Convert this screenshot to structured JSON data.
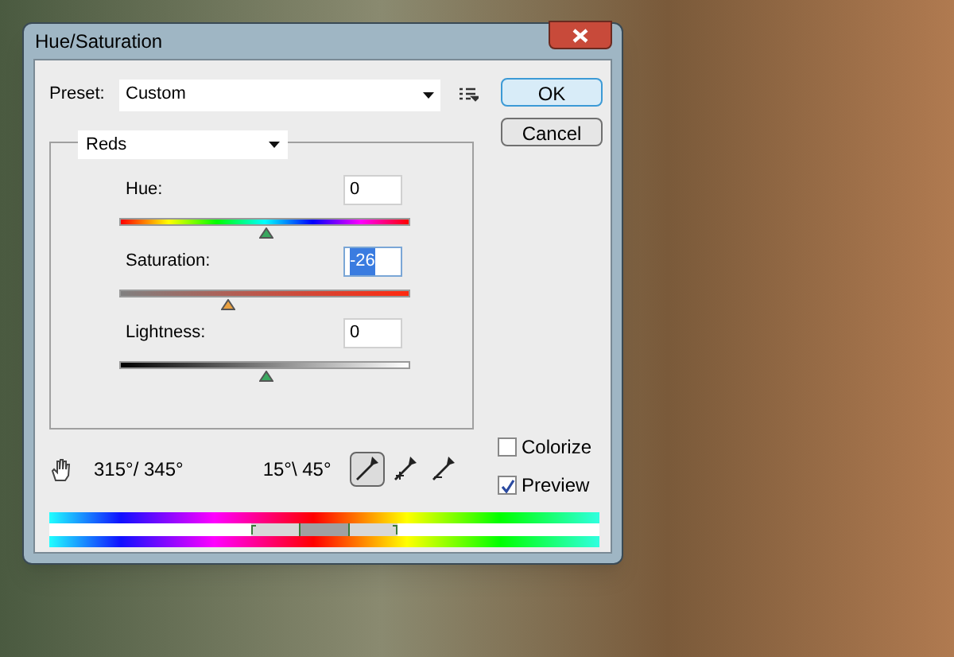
{
  "window": {
    "title": "Hue/Saturation"
  },
  "preset": {
    "label": "Preset:",
    "value": "Custom"
  },
  "buttons": [
    {
      "label": "OK",
      "default": true
    },
    {
      "label": "Cancel",
      "default": false
    }
  ],
  "channel": {
    "value": "Reds"
  },
  "sliders": [
    {
      "kind": "hue",
      "label": "Hue:",
      "value": "0",
      "level": 0.5,
      "focused": false
    },
    {
      "kind": "saturation",
      "label": "Saturation:",
      "value": "-26",
      "level": 0.37,
      "focused": true
    },
    {
      "kind": "lightness",
      "label": "Lightness:",
      "value": "0",
      "level": 0.5,
      "focused": false
    }
  ],
  "range": {
    "left": "315°/ 345°",
    "right": "15°\\ 45°"
  },
  "eyedroppers": [
    {
      "kind": "plain",
      "selected": true
    },
    {
      "kind": "add",
      "selected": false
    },
    {
      "kind": "subtract",
      "selected": false
    }
  ],
  "options": [
    {
      "label": "Colorize",
      "checked": false
    },
    {
      "label": "Preview",
      "checked": true
    }
  ]
}
